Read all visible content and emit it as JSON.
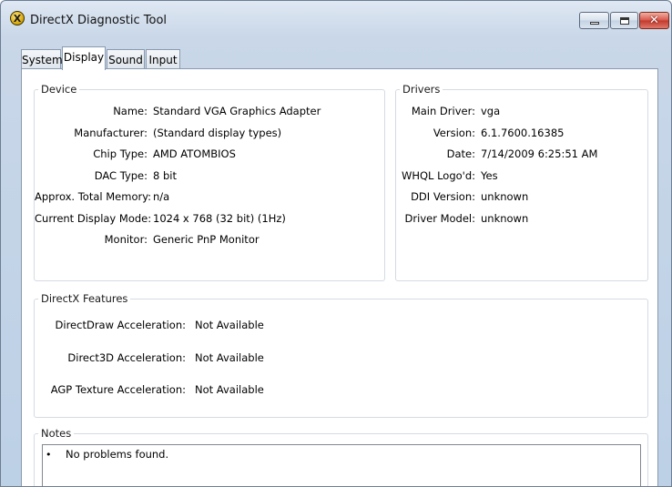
{
  "window": {
    "title": "DirectX Diagnostic Tool"
  },
  "tabs": [
    "System",
    "Display",
    "Sound",
    "Input"
  ],
  "device": {
    "label": "Device",
    "rows": [
      {
        "label": "Name:",
        "value": "Standard VGA Graphics Adapter"
      },
      {
        "label": "Manufacturer:",
        "value": "(Standard display types)"
      },
      {
        "label": "Chip Type:",
        "value": "AMD ATOMBIOS"
      },
      {
        "label": "DAC Type:",
        "value": "8 bit"
      },
      {
        "label": "Approx. Total Memory:",
        "value": "n/a"
      },
      {
        "label": "Current Display Mode:",
        "value": "1024 x 768 (32 bit) (1Hz)"
      },
      {
        "label": "Monitor:",
        "value": "Generic PnP Monitor"
      }
    ]
  },
  "drivers": {
    "label": "Drivers",
    "rows": [
      {
        "label": "Main Driver:",
        "value": "vga"
      },
      {
        "label": "Version:",
        "value": "6.1.7600.16385"
      },
      {
        "label": "Date:",
        "value": "7/14/2009 6:25:51 AM"
      },
      {
        "label": "WHQL Logo'd:",
        "value": "Yes"
      },
      {
        "label": "DDI Version:",
        "value": "unknown"
      },
      {
        "label": "Driver Model:",
        "value": "unknown"
      }
    ]
  },
  "features": {
    "label": "DirectX Features",
    "rows": [
      {
        "label": "DirectDraw Acceleration:",
        "value": "Not Available"
      },
      {
        "label": "Direct3D Acceleration:",
        "value": "Not Available"
      },
      {
        "label": "AGP Texture Acceleration:",
        "value": "Not Available"
      }
    ]
  },
  "notes": {
    "label": "Notes",
    "bullet": "•",
    "items": [
      "No problems found."
    ]
  },
  "icons": {
    "app": "directx-icon",
    "app_glyph": "X",
    "minimize": "minimize-icon",
    "maximize": "maximize-icon",
    "close": "close-icon",
    "close_glyph": "✕"
  }
}
